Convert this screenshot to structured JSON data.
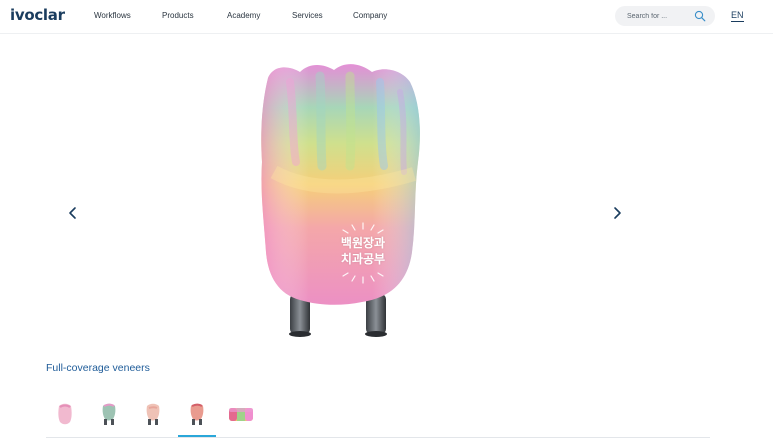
{
  "header": {
    "logo": "ivoclar",
    "nav": [
      "Workflows",
      "Products",
      "Academy",
      "Services",
      "Company"
    ],
    "search_placeholder": "Search for ...",
    "search_icon": "magnifier",
    "language": "EN"
  },
  "gallery": {
    "prev_icon": "chevron-left",
    "next_icon": "chevron-right",
    "image_subject": "multicolor-veneer-tooth-on-stand",
    "watermark": [
      "백원장과",
      "치과공부"
    ],
    "active_index": 3
  },
  "section": {
    "title": "Full-coverage veneers"
  },
  "thumbnails": [
    {
      "icon": "veneer-thumb-pink"
    },
    {
      "icon": "veneer-thumb-crown-stand"
    },
    {
      "icon": "veneer-thumb-light-pink"
    },
    {
      "icon": "veneer-thumb-red-stand"
    },
    {
      "icon": "veneer-thumb-rainbow"
    }
  ],
  "colors": {
    "brand": "#1a3c5e",
    "link": "#1f5c99",
    "active_tab": "#2aa7d9"
  }
}
